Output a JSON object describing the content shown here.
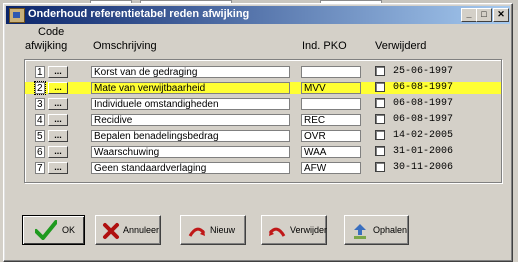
{
  "window": {
    "title": "Onderhoud referentietabel reden afwijking",
    "minimize_glyph": "_",
    "maximize_glyph": "□",
    "close_glyph": "✕"
  },
  "headers": {
    "code_line1": "Code",
    "code_line2": "afwijking",
    "omschrijving": "Omschrijving",
    "ind_pko": "Ind. PKO",
    "verwijderd": "Verwijderd"
  },
  "rows": [
    {
      "code": "1",
      "dots": "...",
      "omschrijving": "Korst van de gedraging",
      "pko": "",
      "verwijderd": false,
      "date": "25-06-1997",
      "highlighted": false
    },
    {
      "code": "2",
      "dots": "...",
      "omschrijving": "Mate van verwijtbaarheid",
      "pko": "MVV",
      "verwijderd": false,
      "date": "06-08-1997",
      "highlighted": true
    },
    {
      "code": "3",
      "dots": "...",
      "omschrijving": "Individuele omstandigheden",
      "pko": "",
      "verwijderd": false,
      "date": "06-08-1997",
      "highlighted": false
    },
    {
      "code": "4",
      "dots": "...",
      "omschrijving": "Recidive",
      "pko": "REC",
      "verwijderd": false,
      "date": "06-08-1997",
      "highlighted": false
    },
    {
      "code": "5",
      "dots": "...",
      "omschrijving": "Bepalen benadelingsbedrag",
      "pko": "OVR",
      "verwijderd": false,
      "date": "14-02-2005",
      "highlighted": false
    },
    {
      "code": "6",
      "dots": "...",
      "omschrijving": "Waarschuwing",
      "pko": "WAA",
      "verwijderd": false,
      "date": "31-01-2006",
      "highlighted": false
    },
    {
      "code": "7",
      "dots": "...",
      "omschrijving": "Geen standaardverlaging",
      "pko": "AFW",
      "verwijderd": false,
      "date": "30-11-2006",
      "highlighted": false
    }
  ],
  "buttons": {
    "ok": "OK",
    "annuleer": "Annuleer",
    "nieuw": "Nieuw",
    "verwijder": "Verwijder",
    "ophalen": "Ophalen"
  },
  "icons": {
    "ok": "check-icon",
    "annuleer": "x-icon",
    "nieuw": "curved-arrow-icon",
    "verwijder": "curved-arrow-icon",
    "ophalen": "retrieve-icon"
  },
  "colors": {
    "highlight": "#ffff33",
    "title_start": "#0a246a",
    "title_end": "#a6caf0",
    "ok_check": "#1f9a1f",
    "cancel_x": "#b01010",
    "arrow": "#c01818"
  }
}
